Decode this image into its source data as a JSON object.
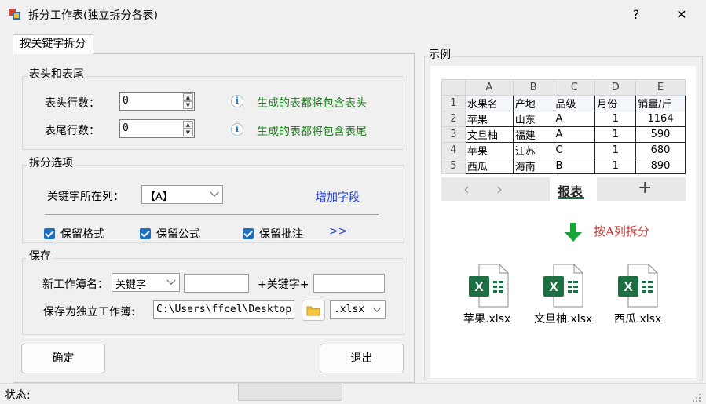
{
  "window": {
    "title": "拆分工作表(独立拆分各表)",
    "help_label": "?",
    "close_label": "✕"
  },
  "tab": {
    "label": "按关键字拆分"
  },
  "header_footer": {
    "group_title": "表头和表尾",
    "header_rows_label": "表头行数：",
    "header_rows_value": "0",
    "header_hint": "生成的表都将包含表头",
    "footer_rows_label": "表尾行数：",
    "footer_rows_value": "0",
    "footer_hint": "生成的表都将包含表尾",
    "info_glyph": "i"
  },
  "split_options": {
    "group_title": "拆分选项",
    "key_column_label": "关键字所在列：",
    "key_column_value": "【A】",
    "add_field_link": "增加字段",
    "keep_format_label": "保留格式",
    "keep_formula_label": "保留公式",
    "keep_comment_label": "保留批注",
    "more_label": ">>",
    "keep_format_checked": true,
    "keep_formula_checked": true,
    "keep_comment_checked": true
  },
  "save": {
    "group_title": "保存",
    "new_book_name_label": "新工作簿名：",
    "name_mode_value": "关键字",
    "prefix_value": "",
    "plus_key_label": "+关键字+",
    "suffix_value": "",
    "save_path_label": "保存为独立工作簿:",
    "save_path_value": "C:\\Users\\ffcel\\Desktop",
    "extension_value": ".xlsx"
  },
  "buttons": {
    "ok_label": "确定",
    "exit_label": "退出"
  },
  "example": {
    "group_title": "示例",
    "columns": [
      "A",
      "B",
      "C",
      "D",
      "E"
    ],
    "row_numbers": [
      "1",
      "2",
      "3",
      "4",
      "5"
    ],
    "rows": [
      [
        "水果名",
        "产地",
        "品级",
        "月份",
        "销量/斤"
      ],
      [
        "苹果",
        "山东",
        "A",
        "1",
        "1164"
      ],
      [
        "文旦柚",
        "福建",
        "A",
        "1",
        "590"
      ],
      [
        "苹果",
        "江苏",
        "C",
        "1",
        "680"
      ],
      [
        "西瓜",
        "海南",
        "B",
        "1",
        "890"
      ]
    ],
    "sheet_tab": "报表",
    "prev_glyph": "‹",
    "next_glyph": "›",
    "add_sheet_glyph": "+",
    "split_caption": "按A列拆分",
    "files": [
      "苹果.xlsx",
      "文旦柚.xlsx",
      "西瓜.xlsx"
    ],
    "excel_letter": "X"
  },
  "status": {
    "label": "状态:"
  },
  "colors": {
    "hint_green": "#1e7d1e",
    "link_blue": "#1f3fc6",
    "excel_green": "#1d6f42",
    "arrow_green": "#1aa33a",
    "caption_red": "#d0312d"
  }
}
